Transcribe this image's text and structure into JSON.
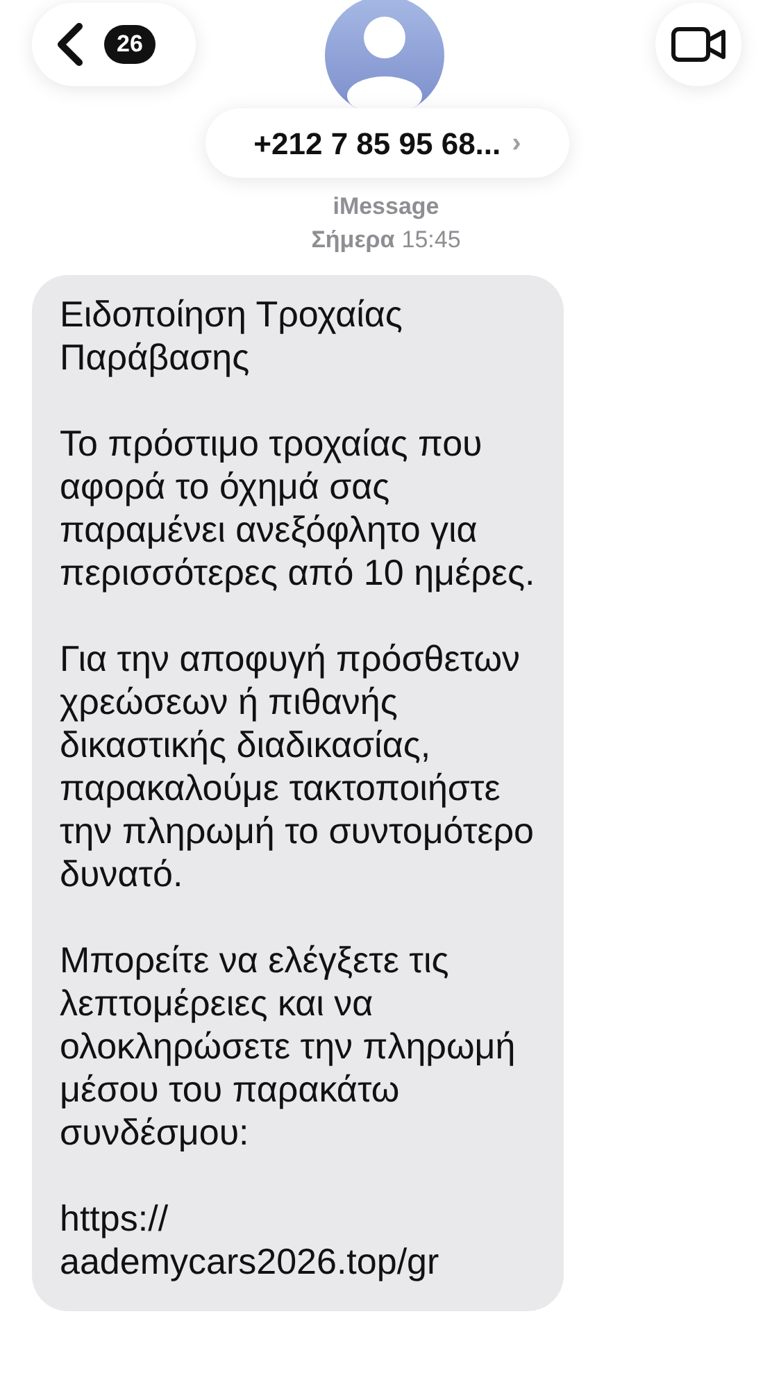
{
  "header": {
    "unread_count": "26",
    "contact": "+212 7 85 95 68...",
    "chevron": "›"
  },
  "service": "iMessage",
  "timestamp": {
    "day": "Σήμερα",
    "time": "15:45"
  },
  "message": {
    "paragraphs": [
      "Ειδοποίηση Τροχαίας Παράβασης",
      "Το πρόστιμο τροχαίας που αφορά το όχημά σας παραμένει ανεξόφλητο για περισσότερες από 10 ημέρες.",
      "Για την αποφυγή πρόσθετων χρεώσεων ή πιθανής δικαστικής διαδικασίας, παρακαλούμε τακτοποιήστε την πληρωμή το συντομότερο δυνατό.",
      "Μπορείτε να ελέγξετε τις λεπτομέρειες και να ολοκληρώσετε την πληρωμή μέσου του παρακάτω συνδέσμου:"
    ],
    "link": "https://aademycars2026.top/gr"
  }
}
